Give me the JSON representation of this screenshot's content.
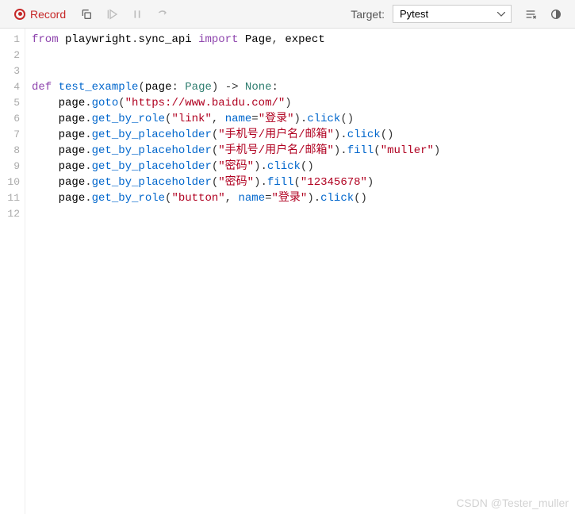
{
  "toolbar": {
    "record_label": "Record",
    "target_label": "Target:",
    "target_value": "Pytest"
  },
  "gutter": {
    "lines": [
      "1",
      "2",
      "3",
      "4",
      "5",
      "6",
      "7",
      "8",
      "9",
      "10",
      "11",
      "12"
    ]
  },
  "code": {
    "l1": {
      "from": "from",
      "mod": "playwright",
      "dot": ".",
      "sub": "sync_api",
      "import": "import",
      "n1": "Page",
      "comma": ",",
      "n2": "expect"
    },
    "l4": {
      "def": "def",
      "fname": "test_example",
      "lp": "(",
      "arg": "page",
      "colon": ":",
      "type": "Page",
      "rp": ")",
      "arrow": "->",
      "ret": "None",
      "end": ":"
    },
    "l5": {
      "obj": "page",
      "dot": ".",
      "m": "goto",
      "lp": "(",
      "s": "\"https://www.baidu.com/\"",
      "rp": ")"
    },
    "l6": {
      "obj": "page",
      "dot": ".",
      "m1": "get_by_role",
      "lp": "(",
      "s1": "\"link\"",
      "comma": ",",
      "kw": "name",
      "eq": "=",
      "s2": "\"登录\"",
      "rp": ")",
      "dot2": ".",
      "m2": "click",
      "lp2": "(",
      "rp2": ")"
    },
    "l7": {
      "obj": "page",
      "dot": ".",
      "m1": "get_by_placeholder",
      "lp": "(",
      "s1": "\"手机号/用户名/邮箱\"",
      "rp": ")",
      "dot2": ".",
      "m2": "click",
      "lp2": "(",
      "rp2": ")"
    },
    "l8": {
      "obj": "page",
      "dot": ".",
      "m1": "get_by_placeholder",
      "lp": "(",
      "s1": "\"手机号/用户名/邮箱\"",
      "rp": ")",
      "dot2": ".",
      "m2": "fill",
      "lp2": "(",
      "s2": "\"muller\"",
      "rp2": ")"
    },
    "l9": {
      "obj": "page",
      "dot": ".",
      "m1": "get_by_placeholder",
      "lp": "(",
      "s1": "\"密码\"",
      "rp": ")",
      "dot2": ".",
      "m2": "click",
      "lp2": "(",
      "rp2": ")"
    },
    "l10": {
      "obj": "page",
      "dot": ".",
      "m1": "get_by_placeholder",
      "lp": "(",
      "s1": "\"密码\"",
      "rp": ")",
      "dot2": ".",
      "m2": "fill",
      "lp2": "(",
      "s2": "\"12345678\"",
      "rp2": ")"
    },
    "l11": {
      "obj": "page",
      "dot": ".",
      "m1": "get_by_role",
      "lp": "(",
      "s1": "\"button\"",
      "comma": ",",
      "kw": "name",
      "eq": "=",
      "s2": "\"登录\"",
      "rp": ")",
      "dot2": ".",
      "m2": "click",
      "lp2": "(",
      "rp2": ")"
    }
  },
  "watermark": "CSDN @Tester_muller"
}
